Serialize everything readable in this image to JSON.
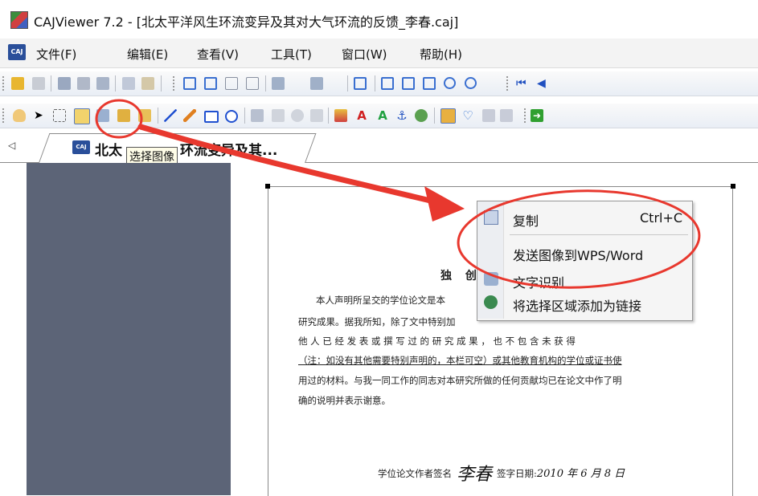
{
  "window": {
    "title": "CAJViewer 7.2 - [北太平洋风生环流变异及其对大气环流的反馈_李春.caj]"
  },
  "menu": {
    "logo": "CAJ",
    "items": [
      "文件(F)",
      "编辑(E)",
      "查看(V)",
      "工具(T)",
      "窗口(W)",
      "帮助(H)"
    ]
  },
  "tab": {
    "title_prefix": "北太",
    "title_suffix": "环流变异及其...",
    "icon_text": "CAJ"
  },
  "tooltip": {
    "text": "选择图像"
  },
  "document": {
    "heading": "独 创",
    "lines": [
      "本人声明所呈交的学位论文是本",
      "研究成果。据我所知，除了文中特别加",
      "他 人 已 经 发 表 或 撰 写 过 的 研 究 成 果 ， 也 不 包 含 未 获 得",
      "（注：如没有其他需要特别声明的，本栏可空）或其他教育机构的学位或证书使",
      "用过的材料。与我一同工作的同志对本研究所做的任何贡献均已在论文中作了明",
      "确的说明并表示谢意。"
    ],
    "signature_label": "学位论文作者签名",
    "signature_value": "李春",
    "date_label": "签字日期:",
    "date_value": "2010 年 6 月 8 日"
  },
  "context_menu": {
    "copy_label": "复制",
    "copy_shortcut": "Ctrl+C",
    "send_label": "发送图像到WPS/Word",
    "ocr_label": "文字识别",
    "link_label": "将选择区域添加为链接"
  },
  "colors": {
    "annotation": "#e8382e",
    "sidebar": "#5c6477"
  }
}
